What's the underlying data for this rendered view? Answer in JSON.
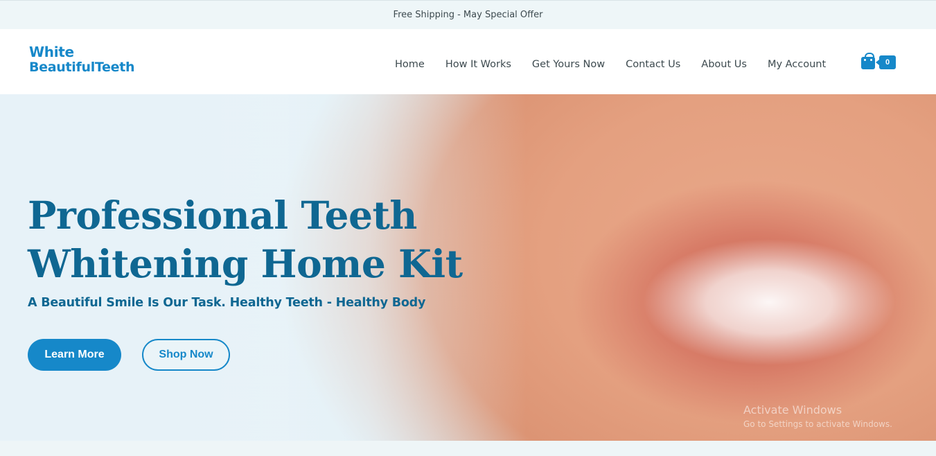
{
  "topbar": {
    "promo_text": "Free Shipping - May Special Offer"
  },
  "header": {
    "logo": {
      "line1": "White",
      "line2": "BeautifulTeeth"
    },
    "nav": [
      {
        "label": "Home"
      },
      {
        "label": "How It Works"
      },
      {
        "label": "Get Yours Now"
      },
      {
        "label": "Contact Us"
      },
      {
        "label": "About Us"
      },
      {
        "label": "My Account"
      }
    ],
    "cart": {
      "icon": "shopping-bag-icon",
      "count": "0"
    }
  },
  "hero": {
    "title_line1": "Professional Teeth",
    "title_line2": "Whitening Home Kit",
    "subtitle": "A Beautiful Smile Is Our Task. Healthy Teeth - Healthy Body",
    "primary_button": "Learn More",
    "secondary_button": "Shop Now"
  },
  "watermark": {
    "line1": "Activate Windows",
    "line2": "Go to Settings to activate Windows."
  },
  "colors": {
    "accent": "#1688c9",
    "heading": "#0f6792",
    "text": "#3d4a4f"
  }
}
